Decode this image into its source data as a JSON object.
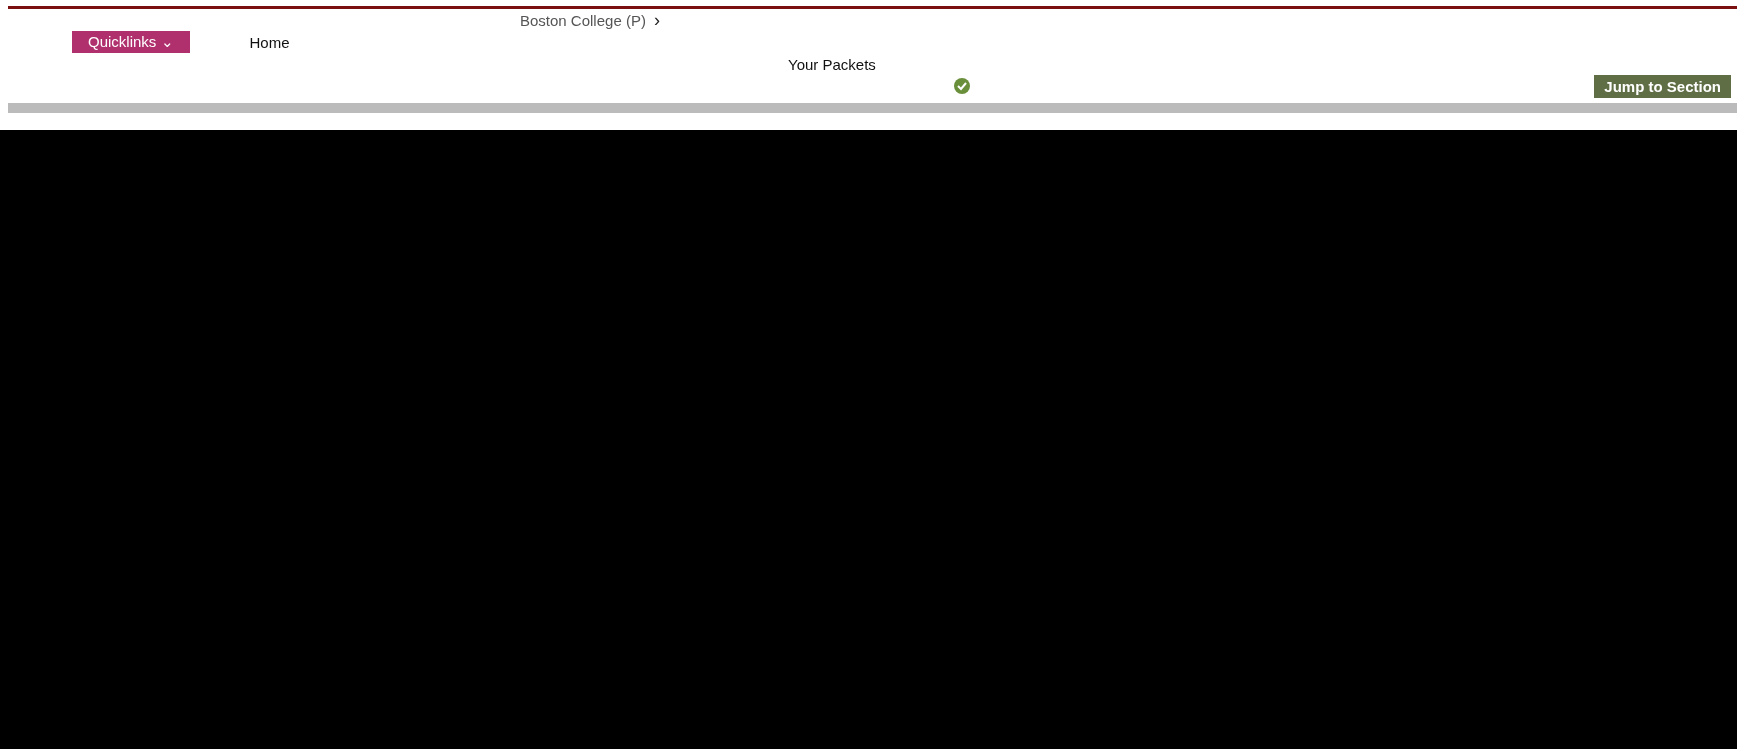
{
  "breadcrumb": {
    "label": "Boston College (P)",
    "chevron": "›"
  },
  "nav": {
    "quicklinks": "Quicklinks",
    "caret": "⌄",
    "home": "Home"
  },
  "packets": {
    "label": "Your Packets"
  },
  "toolbar": {
    "jump": "Jump to Section"
  }
}
